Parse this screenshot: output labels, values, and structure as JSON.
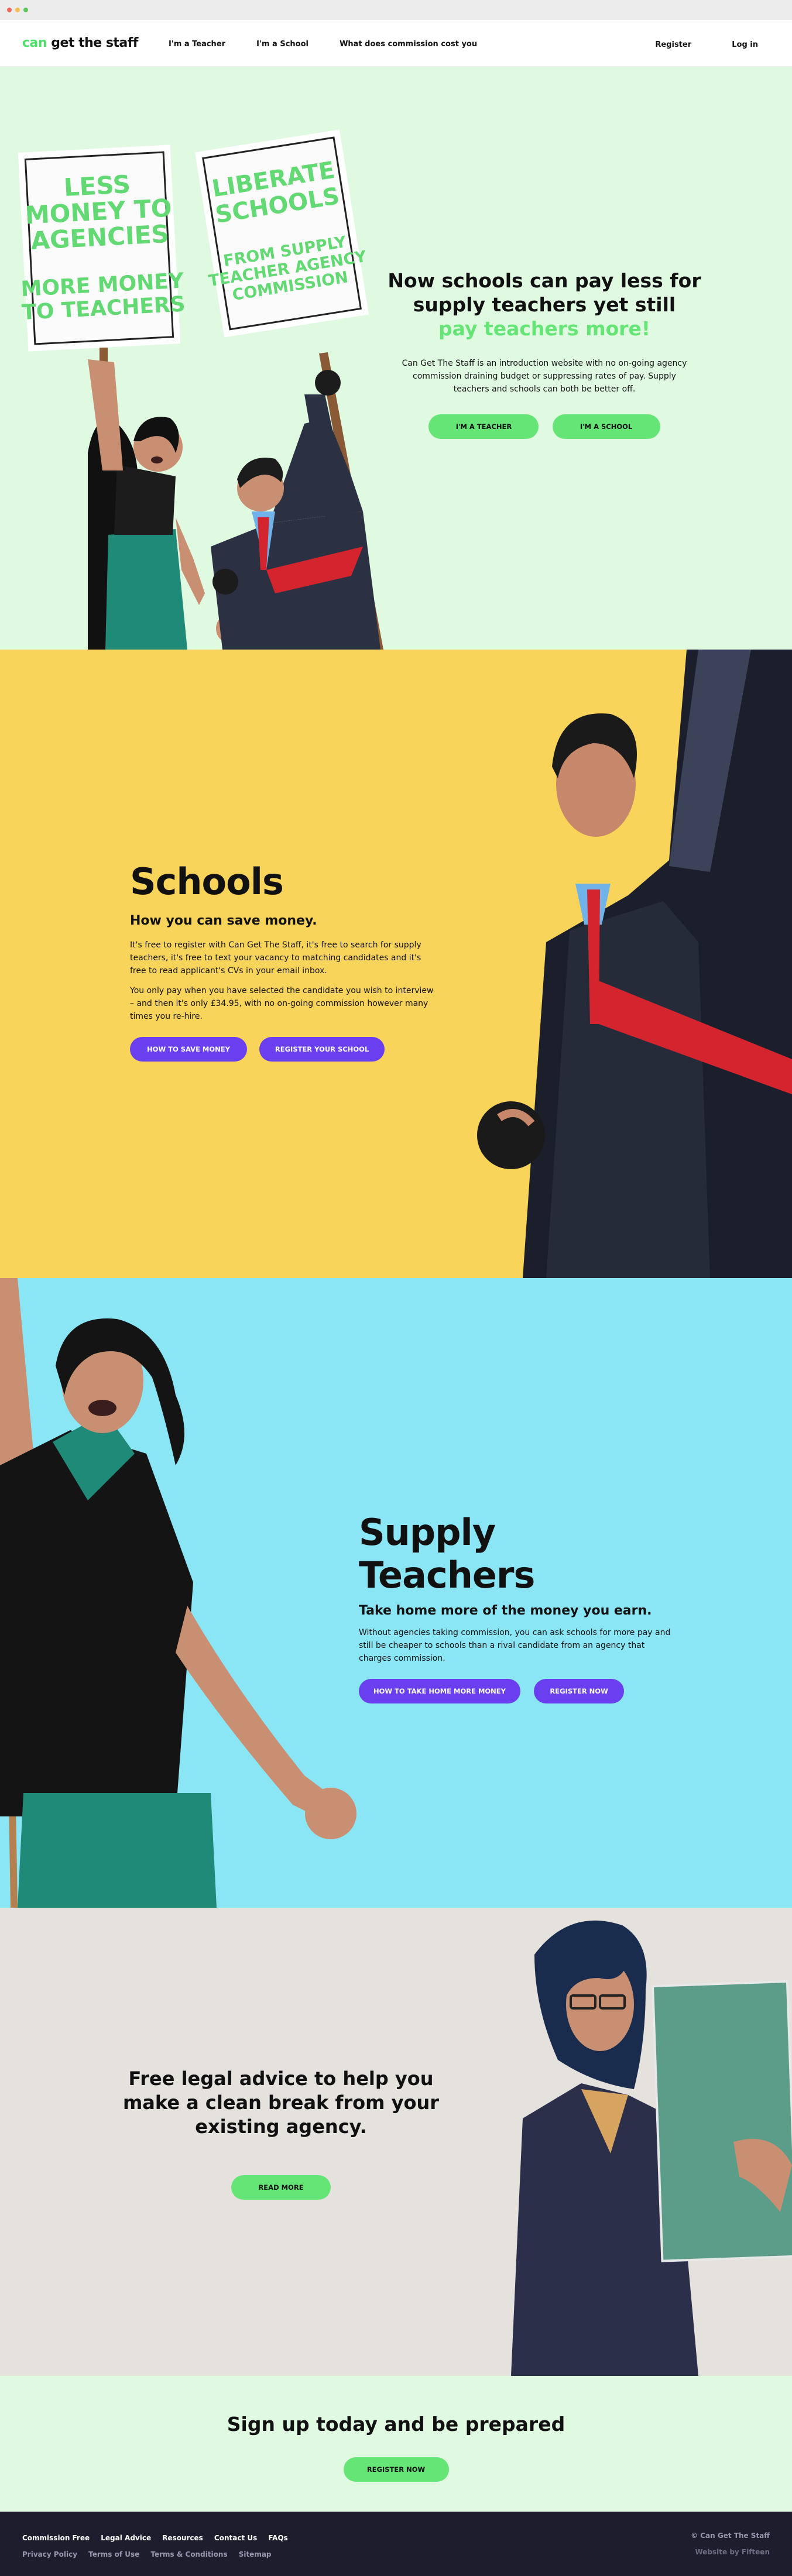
{
  "brand": {
    "logo_can": "can",
    "logo_rest": " get the staff"
  },
  "nav": {
    "teacher": "I'm a Teacher",
    "school": "I'm a School",
    "cost": "What does commission cost you",
    "register": "Register",
    "login": "Log in"
  },
  "hero": {
    "sign_left_1": "LESS",
    "sign_left_2": "MONEY TO",
    "sign_left_3": "AGENCIES",
    "sign_left_4": "MORE MONEY",
    "sign_left_5": "TO TEACHERS",
    "sign_right_1": "LIBERATE",
    "sign_right_2": "SCHOOLS",
    "sign_right_3": "FROM SUPPLY",
    "sign_right_4": "TEACHER AGENCY",
    "sign_right_5": "COMMISSION",
    "title_1": "Now schools can pay less for",
    "title_2": "supply teachers yet still",
    "title_3": "pay teachers more!",
    "body": "Can Get The Staff is an introduction website with no on-going agency commission draining budget or suppressing rates of pay. Supply teachers and schools can both be better off.",
    "btn_teacher": "I'M A TEACHER",
    "btn_school": "I'M A SCHOOL"
  },
  "schools": {
    "title": "Schools",
    "subtitle": "How you can save money.",
    "p1": "It's free to register with Can Get The Staff, it's free to search for supply teachers, it's free to text your vacancy to matching candidates and it's free to read applicant's CVs in your email inbox.",
    "p2": "You only pay when you have selected the candidate you wish to interview – and then it's only £34.95, with no on-going commission however many times you re-hire.",
    "btn_save": "HOW TO SAVE MONEY",
    "btn_register": "REGISTER YOUR SCHOOL"
  },
  "teachers": {
    "title": "Supply Teachers",
    "subtitle": "Take home more of the money you earn.",
    "p1": "Without agencies taking commission, you can ask schools for more pay and still be cheaper to schools than a rival candidate from an agency that charges commission.",
    "btn_more": "HOW TO TAKE HOME MORE MONEY",
    "btn_register": "REGISTER NOW"
  },
  "legal": {
    "title_1": "Free legal advice to help you",
    "title_2": "make a clean break from your",
    "title_3": "existing agency.",
    "btn": "READ MORE"
  },
  "signup": {
    "title": "Sign up today and be prepared",
    "btn": "REGISTER NOW"
  },
  "footer": {
    "links1": [
      "Commission Free",
      "Legal Advice",
      "Resources",
      "Contact Us",
      "FAQs"
    ],
    "links2": [
      "Privacy Policy",
      "Terms of Use",
      "Terms & Conditions",
      "Sitemap"
    ],
    "copyright": "© Can Get The Staff",
    "credit": "Website by Fifteen"
  },
  "colors": {
    "brand_green": "#66e577",
    "purple": "#6a3ff0",
    "hero_bg": "#e0fae2",
    "schools_bg": "#f9d45b",
    "teachers_bg": "#8ae6f5",
    "legal_bg": "#e5e2de",
    "footer_bg": "#1e1d2e"
  }
}
